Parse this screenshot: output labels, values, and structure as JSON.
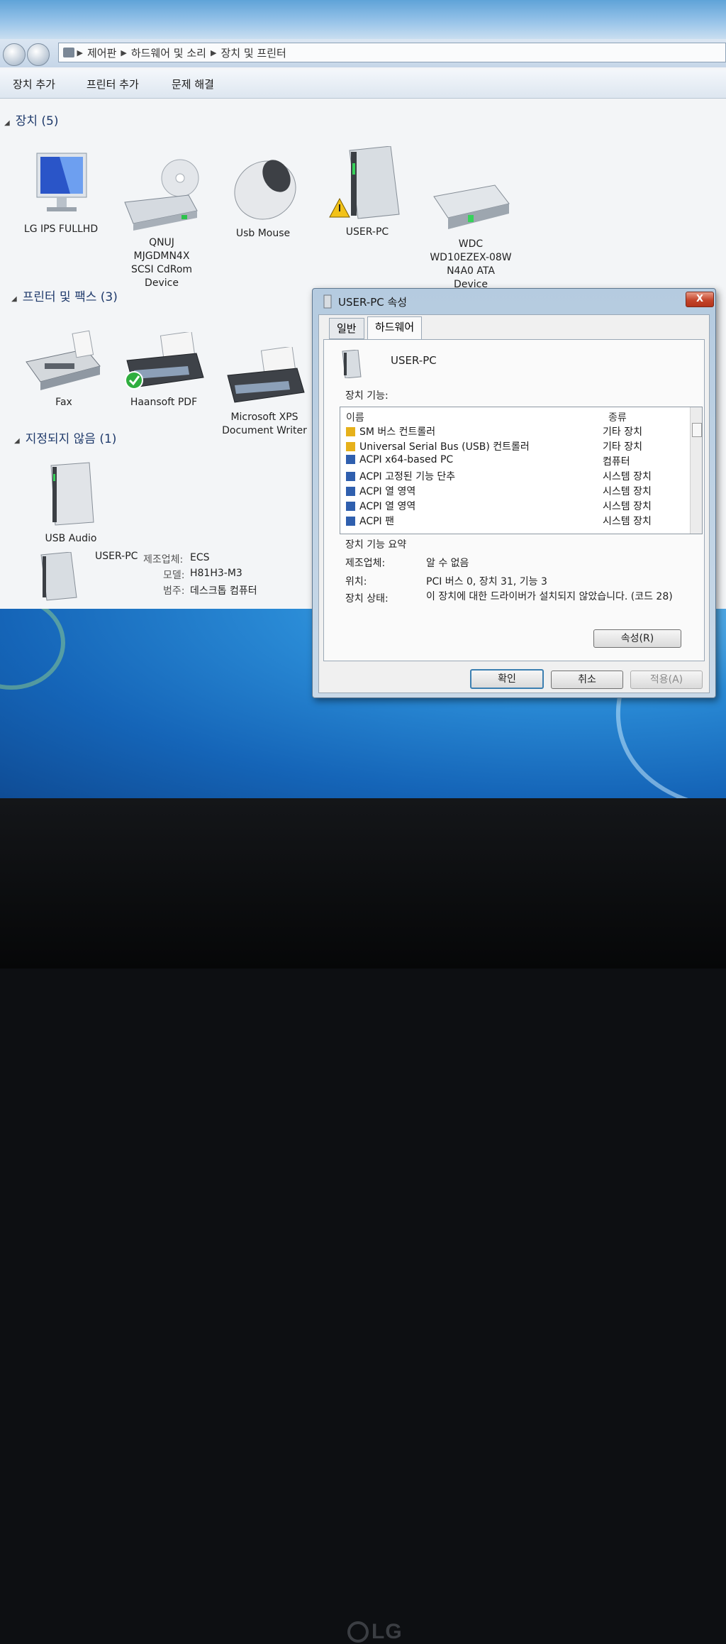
{
  "breadcrumb": [
    "제어판",
    "하드웨어 및 소리",
    "장치 및 프린터"
  ],
  "toolbar": {
    "add_device": "장치 추가",
    "add_printer": "프린터 추가",
    "troubleshoot": "문제 해결"
  },
  "groups": {
    "devices": {
      "title": "장치 (5)",
      "items": [
        {
          "label": "LG IPS FULLHD"
        },
        {
          "label": "QNUJ\nMJGDMN4X\nSCSI CdRom\nDevice"
        },
        {
          "label": "Usb Mouse"
        },
        {
          "label": "USER-PC"
        },
        {
          "label": "WDC\nWD10EZEX-08W\nN4A0 ATA\nDevice"
        }
      ]
    },
    "printers": {
      "title": "프린터 및 팩스 (3)",
      "items": [
        {
          "label": "Fax"
        },
        {
          "label": "Haansoft PDF"
        },
        {
          "label": "Microsoft XPS\nDocument Writer"
        }
      ]
    },
    "unspecified": {
      "title": "지정되지 않음 (1)",
      "items": [
        {
          "label": "USB Audio"
        }
      ]
    }
  },
  "details": {
    "name": "USER-PC",
    "manufacturer_label": "제조업체:",
    "manufacturer": "ECS",
    "model_label": "모델:",
    "model": "H81H3-M3",
    "category_label": "범주:",
    "category": "데스크톱 컴퓨터"
  },
  "dialog": {
    "title": "USER-PC 속성",
    "tabs": [
      "일반",
      "하드웨어"
    ],
    "device_name": "USER-PC",
    "functions_label": "장치 기능:",
    "columns": {
      "name": "이름",
      "type": "종류"
    },
    "rows": [
      {
        "name": "SM 버스 컨트롤러",
        "type": "기타 장치",
        "icon": "warning-device-icon"
      },
      {
        "name": "Universal Serial Bus (USB) 컨트롤러",
        "type": "기타 장치",
        "icon": "warning-device-icon"
      },
      {
        "name": "ACPI x64-based PC",
        "type": "컴퓨터",
        "icon": "computer-device-icon"
      },
      {
        "name": "ACPI 고정된 기능 단추",
        "type": "시스템 장치",
        "icon": "system-device-icon"
      },
      {
        "name": "ACPI 열 영역",
        "type": "시스템 장치",
        "icon": "system-device-icon"
      },
      {
        "name": "ACPI 열 영역",
        "type": "시스템 장치",
        "icon": "system-device-icon"
      },
      {
        "name": "ACPI 팬",
        "type": "시스템 장치",
        "icon": "system-device-icon"
      }
    ],
    "summary_title": "장치 기능 요약",
    "summary": {
      "manufacturer_label": "제조업체:",
      "manufacturer": "알 수 없음",
      "location_label": "위치:",
      "location": "PCI 버스 0, 장치 31, 기능 3",
      "status_label": "장치 상태:",
      "status": "이 장치에 대한 드라이버가 설치되지 않았습니다. (코드 28)"
    },
    "properties_button": "속성(R)",
    "ok_button": "확인",
    "cancel_button": "취소",
    "apply_button": "적용(A)",
    "close_glyph": "X"
  },
  "brand": "LG",
  "colors": {
    "accent": "#3c7fb1",
    "warning": "#e6b11b",
    "close": "#c4452b",
    "desktop": "#2a8bd6"
  }
}
